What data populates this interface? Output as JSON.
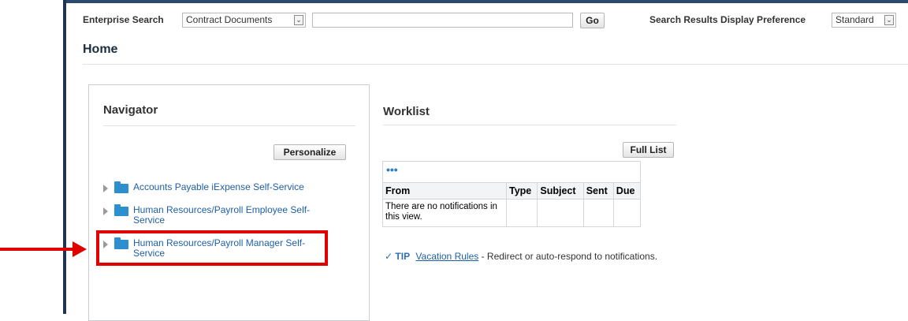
{
  "search": {
    "label": "Enterprise Search",
    "scope_selected": "Contract Documents",
    "query_value": "",
    "go_label": "Go",
    "display_pref_label": "Search Results Display Preference",
    "display_pref_selected": "Standard"
  },
  "page": {
    "title": "Home"
  },
  "navigator": {
    "title": "Navigator",
    "personalize_label": "Personalize",
    "items": [
      {
        "label": "Accounts Payable iExpense Self-Service"
      },
      {
        "label": "Human Resources/Payroll Employee Self-Service"
      },
      {
        "label": "Human Resources/Payroll Manager Self-Service"
      }
    ]
  },
  "worklist": {
    "title": "Worklist",
    "full_list_label": "Full List",
    "more_label": "•••",
    "columns": [
      "From",
      "Type",
      "Subject",
      "Sent",
      "Due"
    ],
    "empty_message": "There are no notifications in this view."
  },
  "tip": {
    "icon": "check-icon",
    "label": "TIP",
    "link_text": "Vacation Rules",
    "text": " - Redirect or auto-respond to notifications."
  },
  "colors": {
    "highlight": "#e00000",
    "link": "#1f5fa6",
    "folder": "#2d8fd0"
  }
}
